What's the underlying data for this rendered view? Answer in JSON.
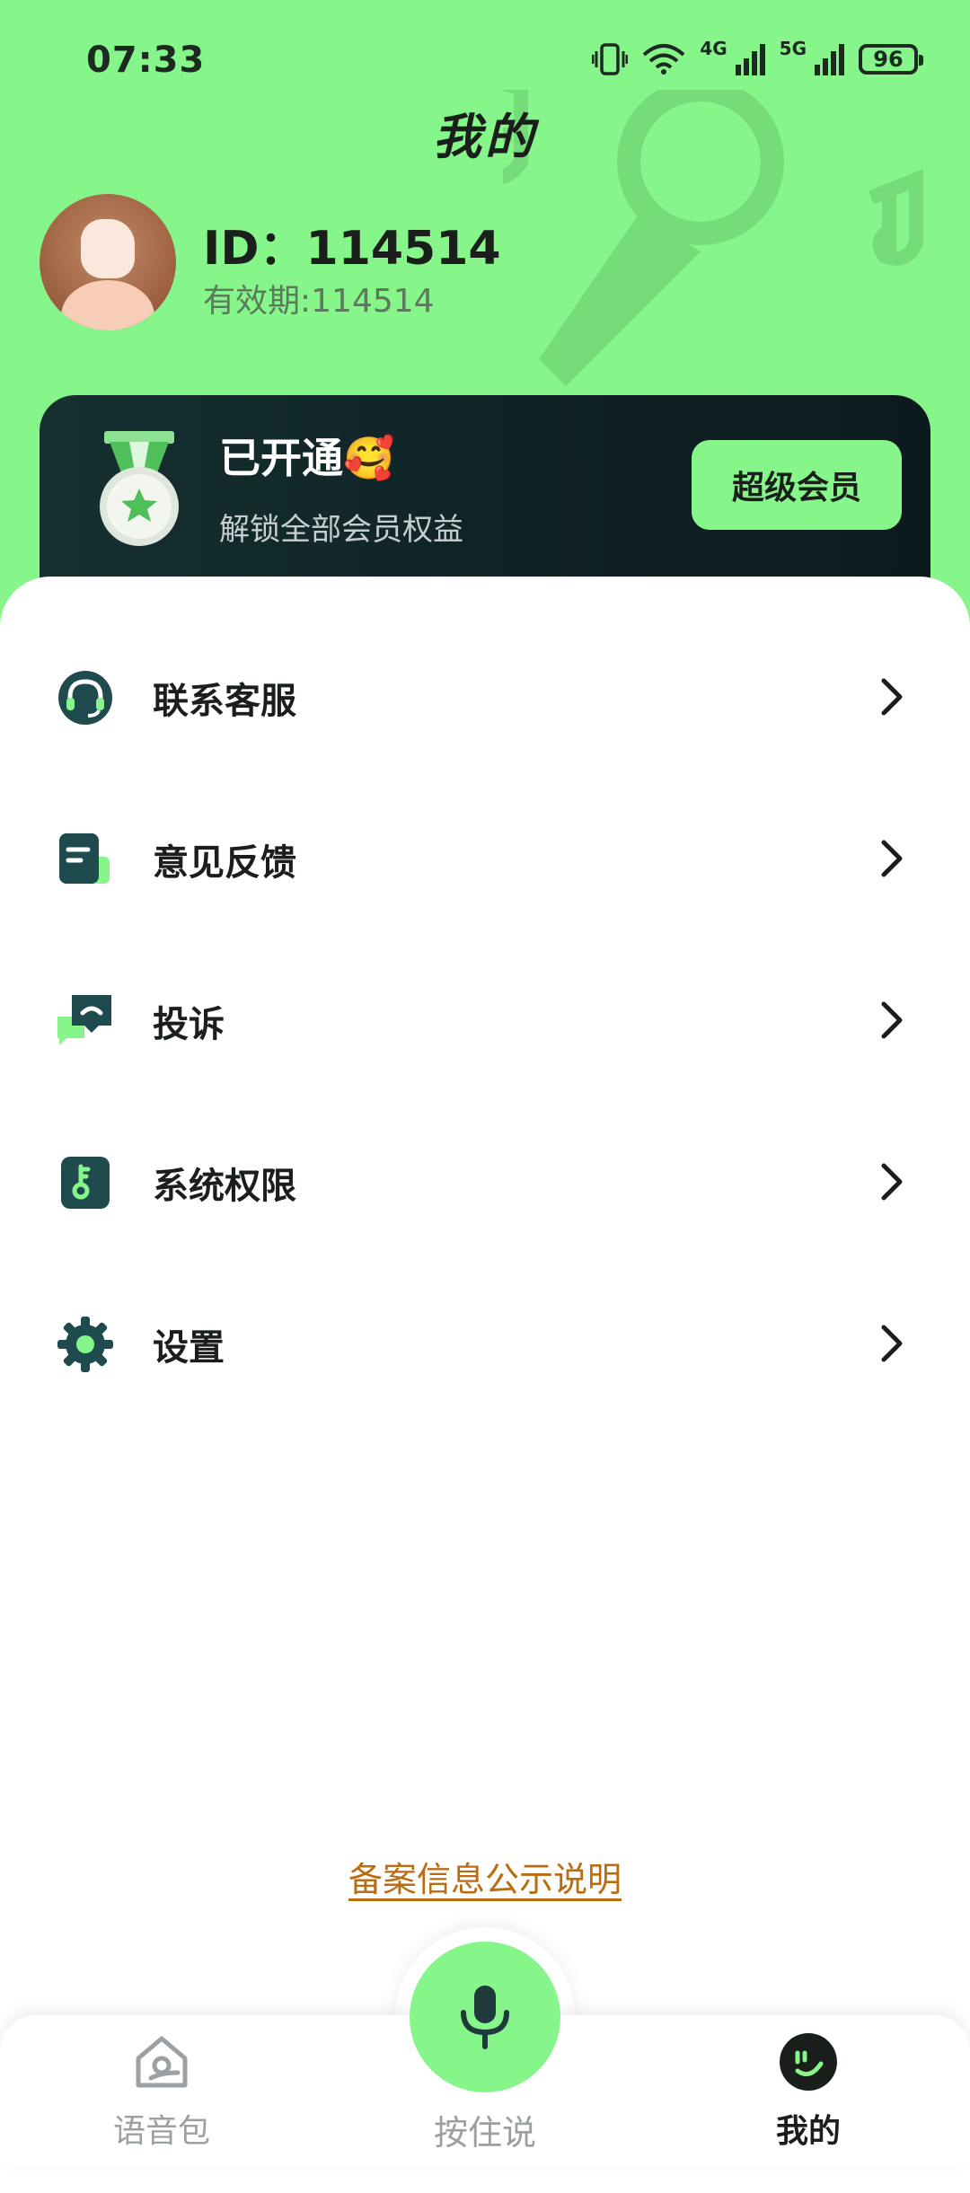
{
  "status_bar": {
    "time": "07:33",
    "net1": "4G",
    "net2": "5G",
    "battery": "96"
  },
  "header": {
    "title": "我的"
  },
  "profile": {
    "id_text": "ID：114514",
    "validity_text": "有效期:114514"
  },
  "vip": {
    "status": "已开通🥰",
    "description": "解锁全部会员权益",
    "button_label": "超级会员"
  },
  "menu": {
    "items": [
      {
        "label": "联系客服",
        "icon": "headset-icon"
      },
      {
        "label": "意见反馈",
        "icon": "feedback-document-icon"
      },
      {
        "label": "投诉",
        "icon": "complaint-chat-icon"
      },
      {
        "label": "系统权限",
        "icon": "permission-key-icon"
      },
      {
        "label": "设置",
        "icon": "gear-icon"
      }
    ]
  },
  "footer": {
    "filing_link": "备案信息公示说明"
  },
  "bottom_nav": {
    "tabs": [
      {
        "label": "语音包",
        "icon": "voice-pack-home-icon",
        "active": false
      },
      {
        "label": "按住说",
        "icon": "microphone-icon",
        "active": false
      },
      {
        "label": "我的",
        "icon": "smiley-icon",
        "active": true
      }
    ]
  },
  "colors": {
    "accent": "#86f58a",
    "card_dark": "#0f2225",
    "link": "#b96c12"
  }
}
